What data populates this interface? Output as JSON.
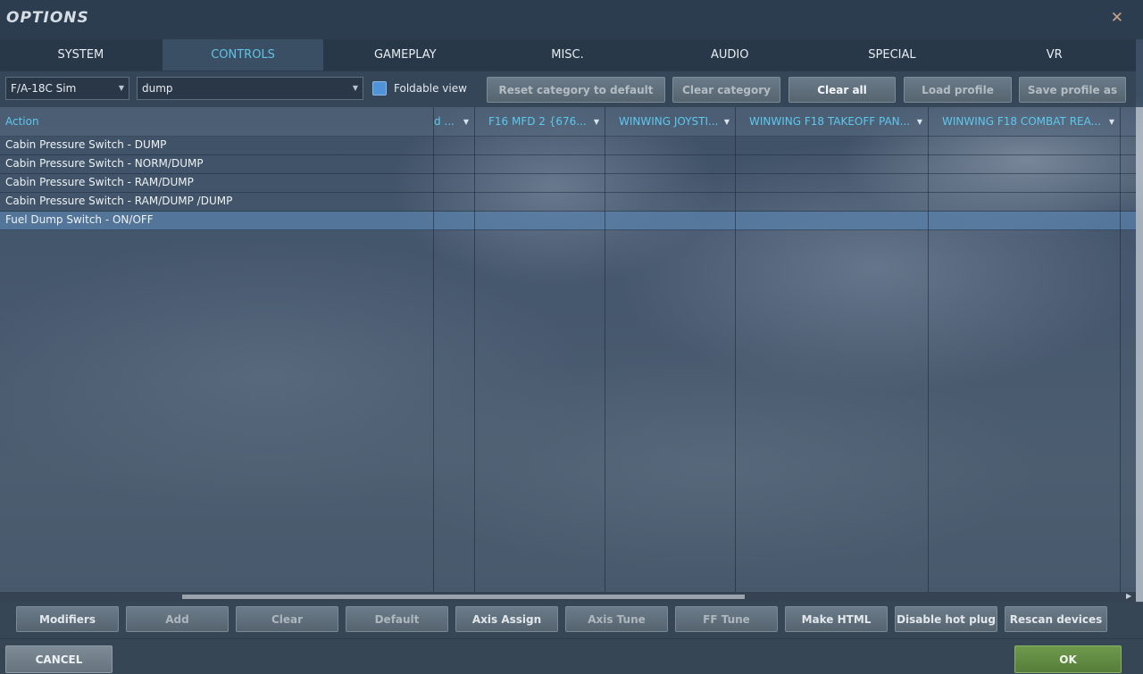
{
  "window": {
    "title": "OPTIONS",
    "close_icon": "close-icon"
  },
  "tabs": [
    {
      "label": "SYSTEM",
      "active": false
    },
    {
      "label": "CONTROLS",
      "active": true
    },
    {
      "label": "GAMEPLAY",
      "active": false
    },
    {
      "label": "MISC.",
      "active": false
    },
    {
      "label": "AUDIO",
      "active": false
    },
    {
      "label": "SPECIAL",
      "active": false
    },
    {
      "label": "VR",
      "active": false
    }
  ],
  "toolbar": {
    "aircraft_select": "F/A-18C Sim",
    "category_select": "dump",
    "foldable_view_label": "Foldable view",
    "foldable_view_checked": true,
    "reset_category_label": "Reset category to default",
    "clear_category_label": "Clear category",
    "clear_all_label": "Clear all",
    "load_profile_label": "Load profile",
    "save_profile_label": "Save profile as"
  },
  "table": {
    "columns": [
      "Action",
      "d ...",
      "F16 MFD 2 {676...",
      "WINWING JOYSTI...",
      "WINWING F18 TAKEOFF PAN...",
      "WINWING F18 COMBAT REA..."
    ],
    "rows": [
      {
        "action": "Cabin Pressure Switch - DUMP",
        "selected": false
      },
      {
        "action": "Cabin Pressure Switch - NORM/DUMP",
        "selected": false
      },
      {
        "action": "Cabin Pressure Switch - RAM/DUMP",
        "selected": false
      },
      {
        "action": "Cabin Pressure Switch - RAM/DUMP /DUMP",
        "selected": false
      },
      {
        "action": "Fuel Dump Switch - ON/OFF",
        "selected": true
      }
    ]
  },
  "bottom_buttons": {
    "modifiers": "Modifiers",
    "add": "Add",
    "clear": "Clear",
    "default": "Default",
    "axis_assign": "Axis Assign",
    "axis_tune": "Axis Tune",
    "ff_tune": "FF Tune",
    "make_html": "Make HTML",
    "disable_hot_plug": "Disable hot plug",
    "rescan_devices": "Rescan devices"
  },
  "footer": {
    "cancel_label": "CANCEL",
    "ok_label": "OK"
  },
  "colors": {
    "accent": "#5fc3e6",
    "ok_green": "#6e9a4c",
    "selected_row": "#5880aa"
  }
}
